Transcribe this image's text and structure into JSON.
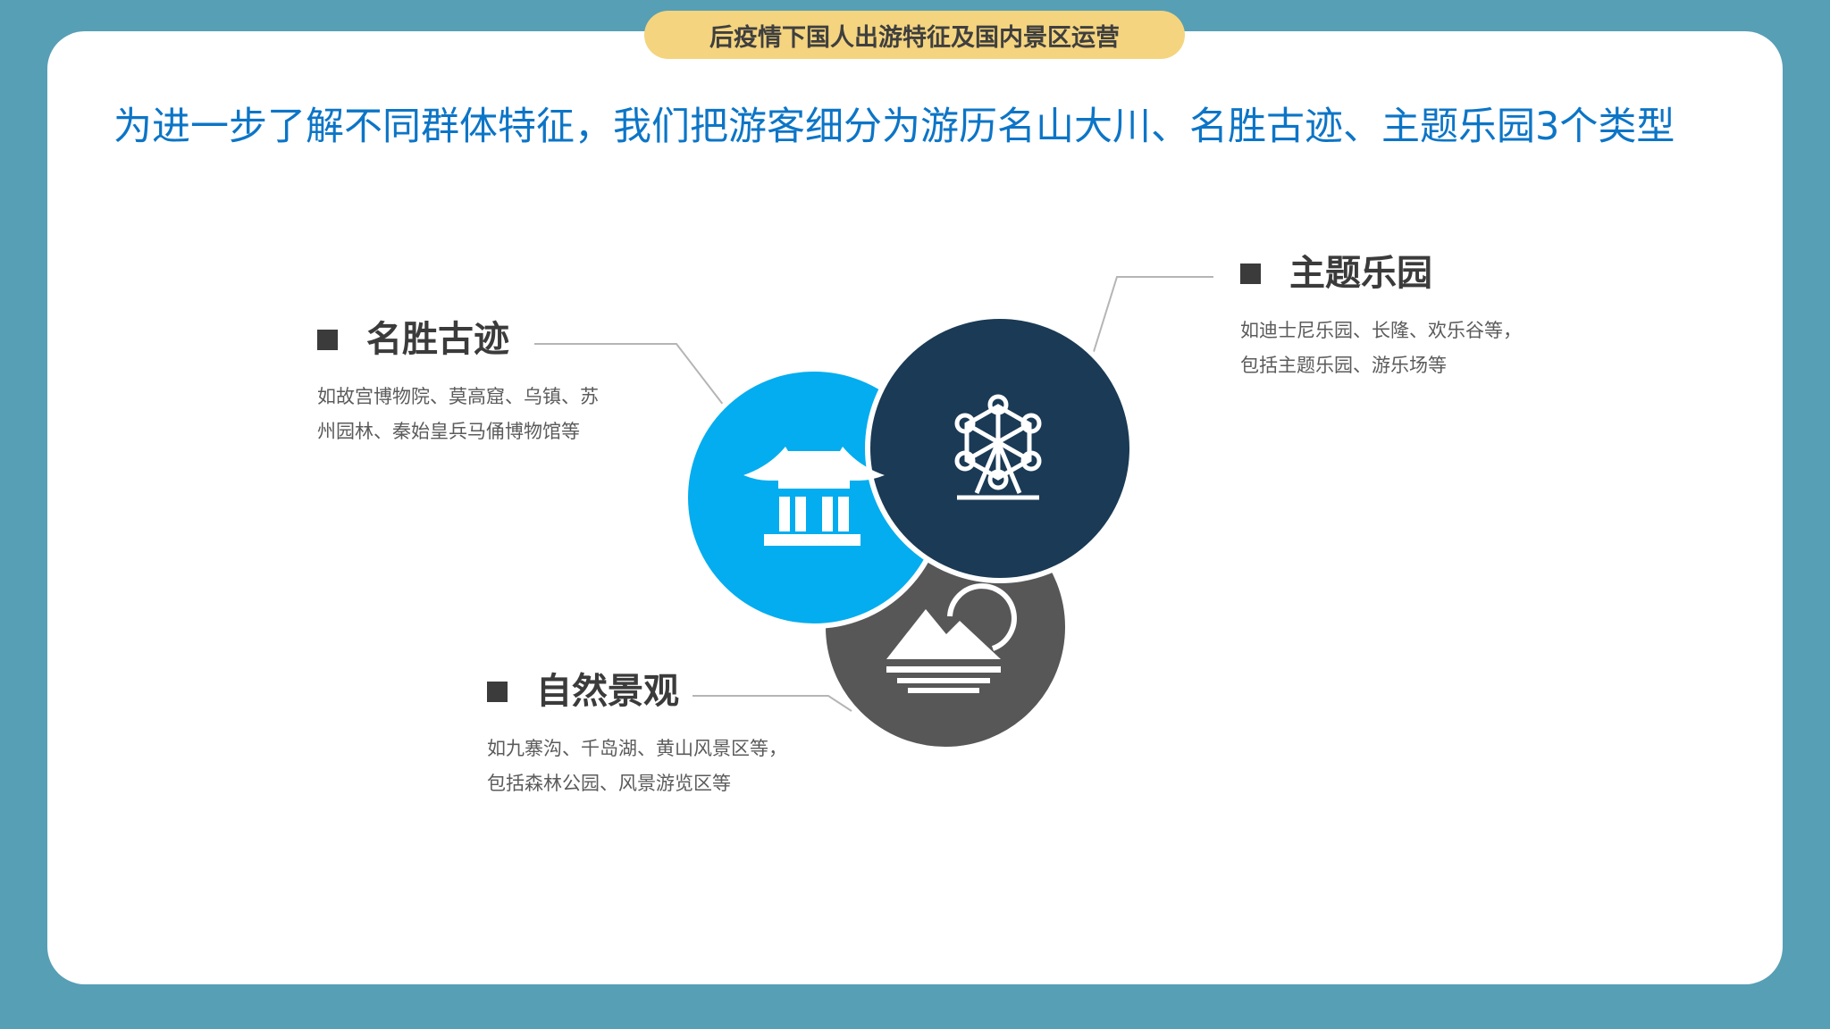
{
  "header": {
    "pill_text": "后疫情下国人出游特征及国内景区运营"
  },
  "headline": "为进一步了解不同群体特征，我们把游客细分为游历名山大川、名胜古迹、主题乐园3个类型",
  "categories": [
    {
      "title": "名胜古迹",
      "description": "如故宫博物院、莫高窟、乌镇、苏\n州园林、秦始皇兵马俑博物馆等",
      "icon": "pagoda-icon",
      "circle_color": "#03adef"
    },
    {
      "title": "主题乐园",
      "description": "如迪士尼乐园、长隆、欢乐谷等，\n包括主题乐园、游乐场等",
      "icon": "ferris-wheel-icon",
      "circle_color": "#1a3a55"
    },
    {
      "title": "自然景观",
      "description": "如九寨沟、千岛湖、黄山风景区等，\n包括森林公园、风景游览区等",
      "icon": "mountain-landscape-icon",
      "circle_color": "#575757"
    }
  ],
  "colors": {
    "background": "#579fb5",
    "card": "#ffffff",
    "pill": "#f4d47f",
    "headline": "#0c75c7",
    "title_text": "#3b3b3b",
    "body_text": "#5b5b5b",
    "connector": "#b5b5b5"
  }
}
